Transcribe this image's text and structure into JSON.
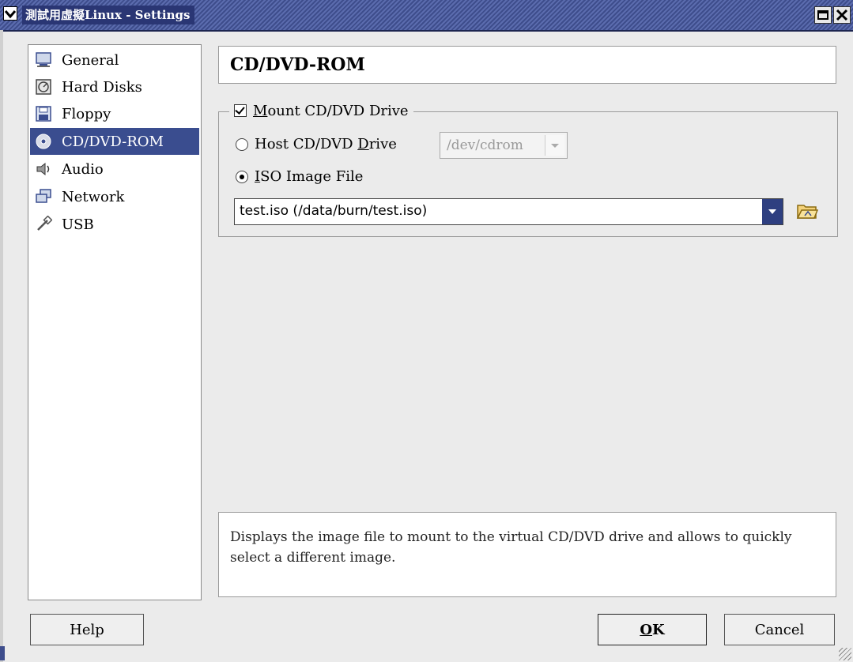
{
  "window": {
    "title": "測試用虛擬Linux - Settings",
    "accent_color": "#3a4d8f"
  },
  "sidebar": {
    "items": [
      {
        "label": "General",
        "icon": "monitor-icon",
        "selected": false
      },
      {
        "label": "Hard Disks",
        "icon": "hard-disk-icon",
        "selected": false
      },
      {
        "label": "Floppy",
        "icon": "floppy-icon",
        "selected": false
      },
      {
        "label": "CD/DVD-ROM",
        "icon": "cd-icon",
        "selected": true
      },
      {
        "label": "Audio",
        "icon": "speaker-icon",
        "selected": false
      },
      {
        "label": "Network",
        "icon": "network-icon",
        "selected": false
      },
      {
        "label": "USB",
        "icon": "usb-icon",
        "selected": false
      }
    ]
  },
  "page": {
    "title": "CD/DVD-ROM"
  },
  "mount_group": {
    "checkbox_prefix": "",
    "checkbox_mnemonic": "M",
    "checkbox_rest": "ount CD/DVD Drive",
    "checked": true,
    "host_drive": {
      "label_start": "Host CD/DVD ",
      "label_mnemonic": "D",
      "label_end": "rive",
      "selected": false,
      "value": "/dev/cdrom"
    },
    "iso_file": {
      "label_mnemonic": "I",
      "label_rest": "SO Image File",
      "selected": true,
      "value": "test.iso (/data/burn/test.iso)"
    }
  },
  "description": "Displays the image file to mount to the virtual CD/DVD drive and allows to quickly select a different image.",
  "buttons": {
    "help": "Help",
    "ok_mnemonic": "O",
    "ok_rest": "K",
    "cancel": "Cancel"
  }
}
